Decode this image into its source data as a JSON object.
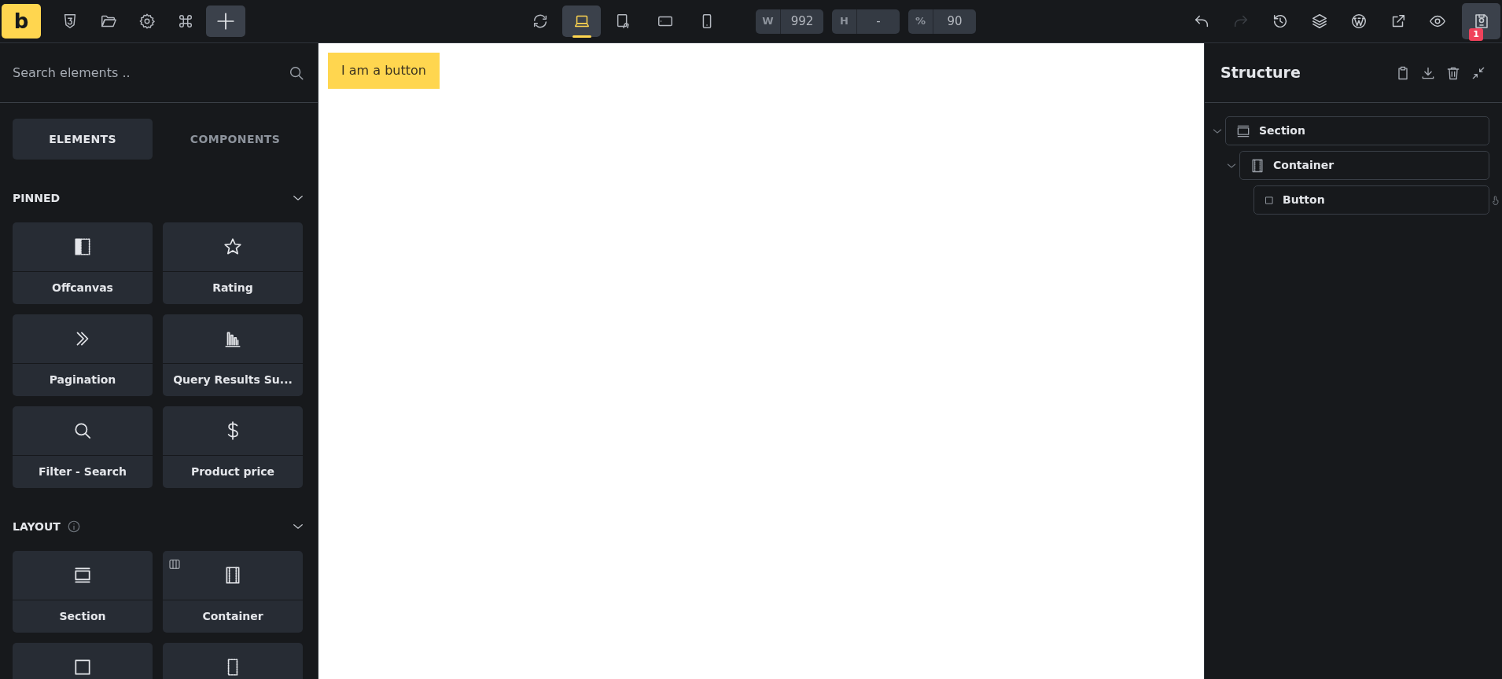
{
  "toolbar_left": {
    "logo": "b",
    "tools": [
      {
        "kind": "css"
      },
      {
        "kind": "folder"
      },
      {
        "kind": "settings"
      },
      {
        "kind": "command"
      },
      {
        "kind": "add"
      }
    ]
  },
  "toolbar_center": {
    "devices": [
      {
        "kind": "refresh",
        "selected": false
      },
      {
        "kind": "laptop",
        "selected": true
      },
      {
        "kind": "tablet-landscape",
        "selected": false
      },
      {
        "kind": "tablet",
        "selected": false
      },
      {
        "kind": "phone",
        "selected": false
      }
    ],
    "fields": [
      {
        "label": "W",
        "value": "992"
      },
      {
        "label": "H",
        "value": "-"
      },
      {
        "label": "%",
        "value": "90"
      }
    ]
  },
  "toolbar_right": {
    "tools": [
      {
        "kind": "undo",
        "disabled": false
      },
      {
        "kind": "redo",
        "disabled": true
      },
      {
        "kind": "history",
        "disabled": false
      },
      {
        "kind": "layers",
        "disabled": false
      },
      {
        "kind": "wordpress",
        "disabled": false
      },
      {
        "kind": "external",
        "disabled": false
      },
      {
        "kind": "preview",
        "disabled": false
      }
    ],
    "save": {
      "badge": "1"
    }
  },
  "sidebar": {
    "search": {
      "placeholder": "Search elements .."
    },
    "tabs": [
      {
        "label": "ELEMENTS",
        "selected": true
      },
      {
        "label": "COMPONENTS",
        "selected": false
      }
    ],
    "groups": [
      {
        "title": "PINNED",
        "info": false,
        "expanded": true,
        "items": [
          {
            "label": "Offcanvas",
            "kind": "offcanvas"
          },
          {
            "label": "Rating",
            "kind": "rating"
          },
          {
            "label": "Pagination",
            "kind": "pagination"
          },
          {
            "label": "Query Results Su...",
            "kind": "query"
          },
          {
            "label": "Filter - Search",
            "kind": "search"
          },
          {
            "label": "Product price",
            "kind": "price"
          }
        ]
      },
      {
        "title": "LAYOUT",
        "info": true,
        "expanded": true,
        "items": [
          {
            "label": "Section",
            "kind": "section"
          },
          {
            "label": "Container",
            "kind": "container"
          },
          {
            "kind": "block"
          },
          {
            "kind": "div"
          }
        ]
      }
    ]
  },
  "canvas": {
    "button": "I am a button"
  },
  "structure": {
    "title": "Structure",
    "tree": [
      {
        "label": "Section",
        "kind": "section",
        "expanded": true,
        "children": [
          {
            "label": "Container",
            "kind": "container",
            "expanded": true,
            "children": [
              {
                "label": "Button",
                "kind": "button"
              }
            ]
          }
        ]
      }
    ]
  }
}
